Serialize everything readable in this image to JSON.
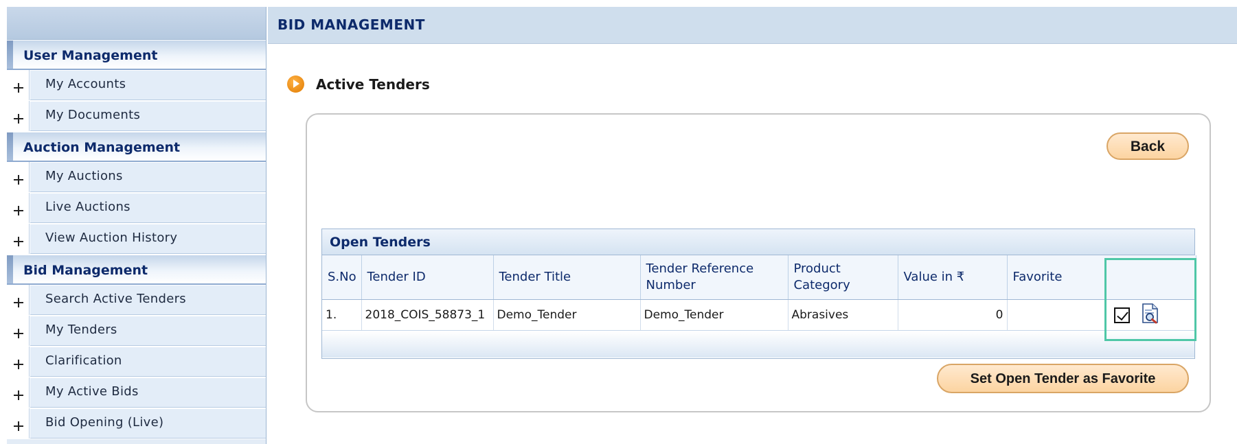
{
  "sidebar": {
    "sections": [
      {
        "title": "User Management",
        "items": [
          "My Accounts",
          "My Documents"
        ]
      },
      {
        "title": "Auction Management",
        "items": [
          "My Auctions",
          "Live Auctions",
          "View Auction History"
        ]
      },
      {
        "title": "Bid Management",
        "items": [
          "Search Active Tenders",
          "My Tenders",
          "Clarification",
          "My Active Bids",
          "Bid Opening (Live)"
        ]
      }
    ]
  },
  "header": {
    "title": "BID MANAGEMENT"
  },
  "section": {
    "title": "Active Tenders"
  },
  "buttons": {
    "back": "Back",
    "set_favorite": "Set Open Tender as Favorite"
  },
  "table": {
    "caption": "Open Tenders",
    "columns": [
      "S.No",
      "Tender ID",
      "Tender Title",
      "Tender Reference Number",
      "Product Category",
      "Value in ₹",
      "Favorite"
    ],
    "rows": [
      {
        "sno": "1.",
        "tender_id": "2018_COIS_58873_1",
        "title": "Demo_Tender",
        "ref": "Demo_Tender",
        "category": "Abrasives",
        "value": "0"
      }
    ]
  },
  "icons": {
    "arrow": "orange-arrow-icon",
    "plus": "plus-icon",
    "checkbox": "checkbox-checked-icon",
    "view": "view-document-icon"
  },
  "colors": {
    "header_text": "#0d2a6b",
    "highlight": "#4fc7a7",
    "button_fill": "#fcd4a1",
    "arrow": "#f08c00"
  }
}
